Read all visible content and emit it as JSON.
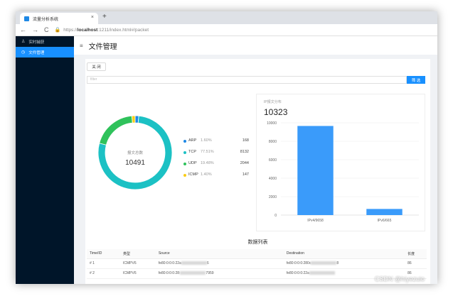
{
  "browser": {
    "tab_title": "流量分析系统",
    "tab_close": "×",
    "new_tab": "+",
    "url_prefix": "https://",
    "url_host": "localhost",
    "url_rest": ":1211/index.html#/packet",
    "nav_back": "←",
    "nav_forward": "→",
    "nav_reload": "C"
  },
  "sidebar": {
    "items": [
      {
        "label": "实时捕获",
        "icon": "user-icon"
      },
      {
        "label": "文件管理",
        "icon": "clock-icon"
      }
    ]
  },
  "header": {
    "title": "文件管理",
    "menu_icon": "≡"
  },
  "toolbar": {
    "close_label": "关 闭",
    "filter_placeholder": "filter",
    "filter_button": "筛 选"
  },
  "pie": {
    "center_label": "报文总数",
    "total": "10491",
    "legend": [
      {
        "name": "ARP",
        "pct": "1.60%",
        "count": "168",
        "color": "#1e88e5"
      },
      {
        "name": "TCP",
        "pct": "77.51%",
        "count": "8132",
        "color": "#1cc1c4"
      },
      {
        "name": "UDP",
        "pct": "19.48%",
        "count": "2044",
        "color": "#2fc25b"
      },
      {
        "name": "ICMP",
        "pct": "1.40%",
        "count": "147",
        "color": "#facc14"
      }
    ]
  },
  "bar": {
    "subtitle": "IP报文分布",
    "total": "10323"
  },
  "chart_data": {
    "type": "bar",
    "categories": [
      "IPv4/9658",
      "IPv6/665"
    ],
    "values": [
      9658,
      665
    ],
    "ylim": [
      0,
      10000
    ],
    "yticks": [
      "0",
      "2000",
      "4000",
      "6000",
      "8000",
      "10000"
    ],
    "color": "#3a9bfa",
    "grid": true
  },
  "table": {
    "title": "数据列表",
    "headers": [
      "Time/ID",
      "类型",
      "Source",
      "Destination",
      "长度"
    ],
    "rows": [
      {
        "id": "# 1",
        "type": "ICMPV6",
        "source_a": "fe80:0:0:0:22a",
        "source_b": "6",
        "dest_a": "fe80:0:0:0:280c",
        "dest_b": "8",
        "len": "86"
      },
      {
        "id": "# 2",
        "type": "ICMPV6",
        "source_a": "fe80:0:0:0:28:",
        "source_b": "7959",
        "dest_a": "fe80:0:0:0:22a",
        "dest_b": "",
        "len": "86"
      }
    ]
  },
  "watermark": "CSDN @hiyezuio"
}
